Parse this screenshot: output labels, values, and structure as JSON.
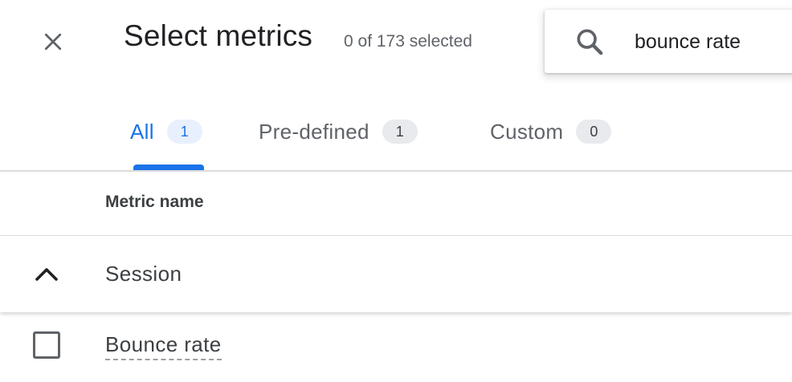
{
  "header": {
    "title": "Select metrics",
    "selected_count": "0 of 173 selected"
  },
  "search": {
    "value": "bounce rate",
    "icon": "search-icon"
  },
  "tabs": [
    {
      "label": "All",
      "count": "1",
      "active": true
    },
    {
      "label": "Pre-defined",
      "count": "1",
      "active": false
    },
    {
      "label": "Custom",
      "count": "0",
      "active": false
    }
  ],
  "table": {
    "column_header": "Metric name",
    "groups": [
      {
        "label": "Session",
        "expanded": true,
        "items": [
          {
            "label": "Bounce rate",
            "checked": false
          }
        ]
      }
    ]
  },
  "colors": {
    "accent": "#1a73e8",
    "text": "#3c4043",
    "muted": "#5f6368",
    "badge_bg": "#e8eaed",
    "active_badge_bg": "#e8f0fe"
  }
}
